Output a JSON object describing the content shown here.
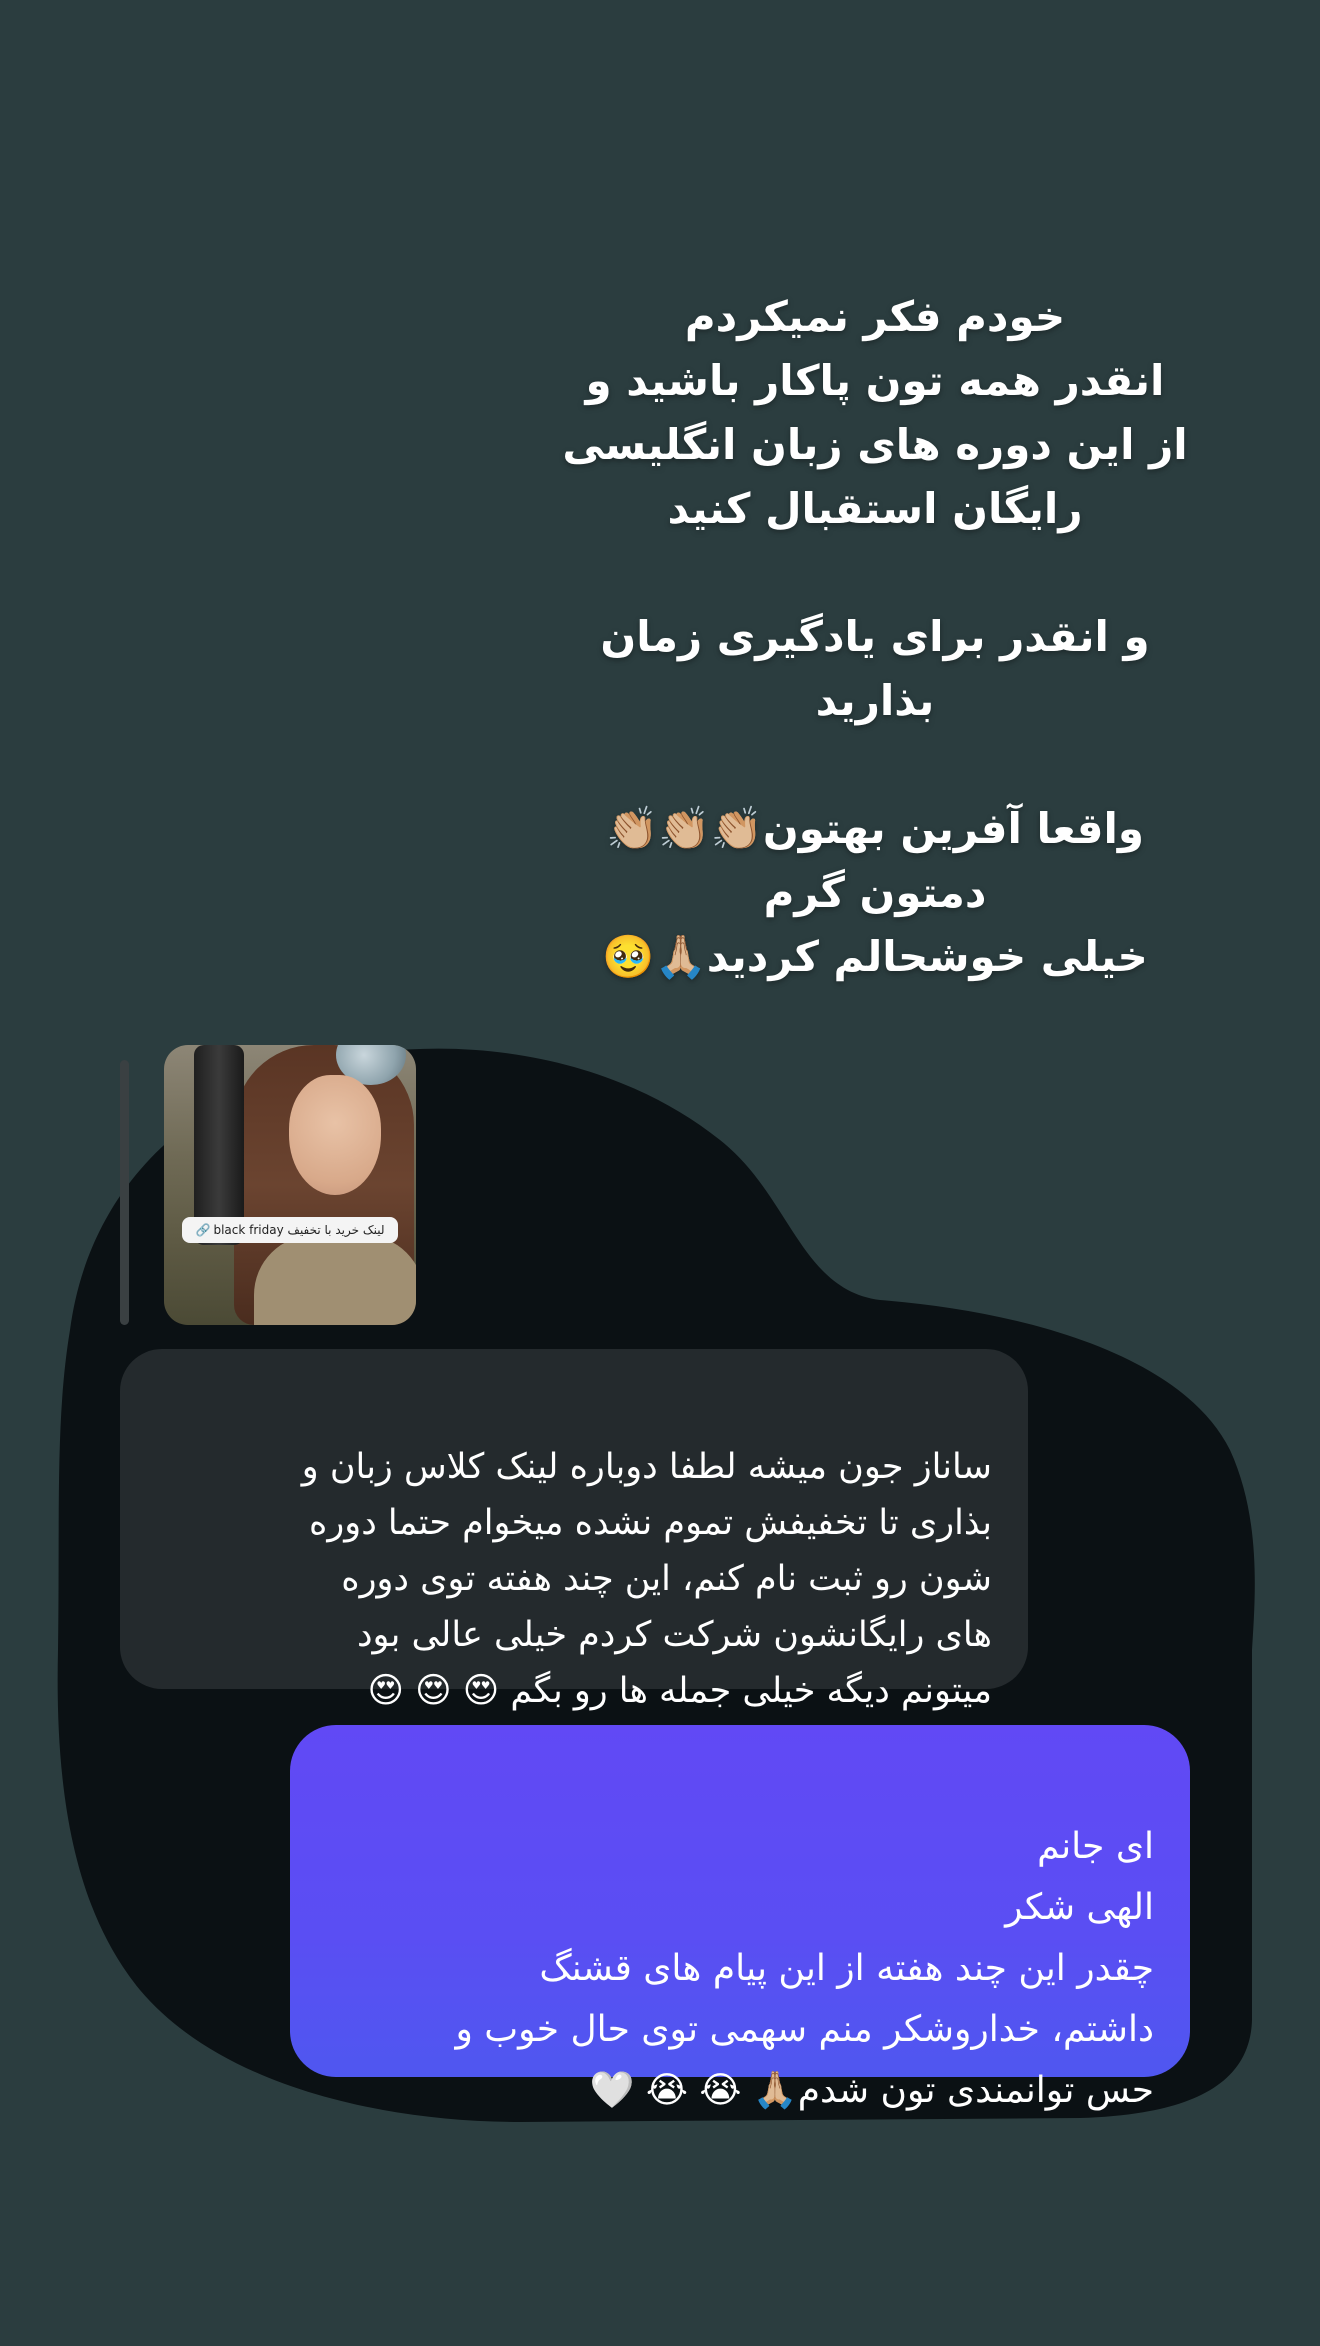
{
  "colors": {
    "background": "#2b3d3f",
    "chat_backdrop": "#0b1114",
    "received_bubble": "#242a2d",
    "sent_bubble_top": "#6149f5",
    "sent_bubble_bottom": "#4f57f0",
    "text": "#ffffff"
  },
  "headline": {
    "text": "خودم فکر نمیکردم\nانقدر همه تون پاکار باشید و\nاز این دوره های زبان انگلیسی\nرایگان استقبال کنید\n\nو انقدر برای یادگیری زمان\nبذارید\n\nواقعا آفرین بهتون👏🏼👏🏼👏🏼\nدمتون گرم\nخیلی خوشحالم کردید🙏🏼🥹"
  },
  "story_preview": {
    "link_label": "black friday لینک خرید با تخفیف",
    "link_icon": "link-icon"
  },
  "messages": {
    "received": {
      "text": "ساناز جون میشه لطفا دوباره لینک کلاس زبان و\nبذاری تا تخفیفش تموم نشده میخوام حتما دوره\nشون رو ثبت نام کنم، این چند هفته توی دوره\nهای رایگانشون شرکت کردم خیلی عالی بود\nمیتونم دیگه خیلی جمله ها رو بگم 😍 😍 😍"
    },
    "sent": {
      "text": "ای جانم\nالهی شکر\nچقدر این چند هفته از این پیام های قشنگ\nداشتم، خداروشکر منم سهمی توی حال خوب و\nحس توانمندی تون شدم🙏🏼 😭 😭 🤍"
    }
  }
}
